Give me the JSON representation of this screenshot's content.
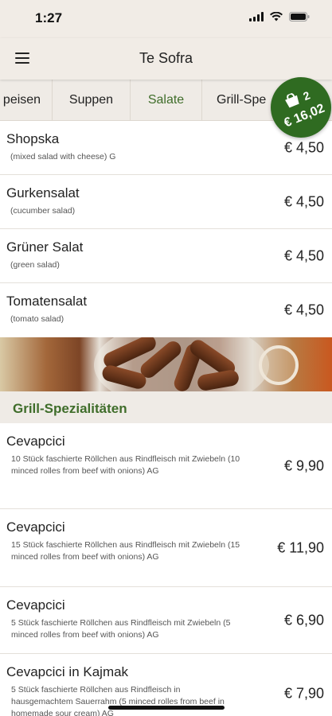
{
  "status_bar": {
    "time": "1:27"
  },
  "nav": {
    "title": "Te Sofra"
  },
  "tabs": [
    {
      "label": "peisen"
    },
    {
      "label": "Suppen"
    },
    {
      "label": "Salate"
    },
    {
      "label": "Grill-Spe"
    }
  ],
  "cart": {
    "count": "2",
    "total": "€ 16,02"
  },
  "salads": [
    {
      "name": "Shopska",
      "desc": "(mixed salad with cheese) G",
      "price": "€ 4,50"
    },
    {
      "name": "Gurkensalat",
      "desc": "(cucumber salad)",
      "price": "€ 4,50"
    },
    {
      "name": "Grüner Salat",
      "desc": "(green salad)",
      "price": "€ 4,50"
    },
    {
      "name": "Tomatensalat",
      "desc": "(tomato salad)",
      "price": "€ 4,50"
    }
  ],
  "grill_section": {
    "title": "Grill-Spezialitäten"
  },
  "grill": [
    {
      "name": "Cevapcici",
      "desc": "10 Stück faschierte Röllchen aus Rindfleisch mit Zwiebeln (10 minced rolles from beef with onions) AG",
      "price": "€ 9,90"
    },
    {
      "name": "Cevapcici",
      "desc": "15 Stück faschierte Röllchen aus Rindfleisch mit Zwiebeln (15 minced rolles from beef with onions) AG",
      "price": "€ 11,90"
    },
    {
      "name": "Cevapcici",
      "desc": "5 Stück faschierte Röllchen aus Rindfleisch mit Zwiebeln (5 minced rolles from beef with onions) AG",
      "price": "€ 6,90"
    },
    {
      "name": "Cevapcici in Kajmak",
      "desc": "5 Stück faschierte Röllchen aus Rindfleisch in hausgemachtem Sauerrahm (5 minced rolles from beef in homemade sour cream) AG",
      "price": "€ 7,90"
    }
  ],
  "colors": {
    "accent": "#3f6d2a",
    "cart_badge": "#2f6b21",
    "background": "#efebe6"
  }
}
